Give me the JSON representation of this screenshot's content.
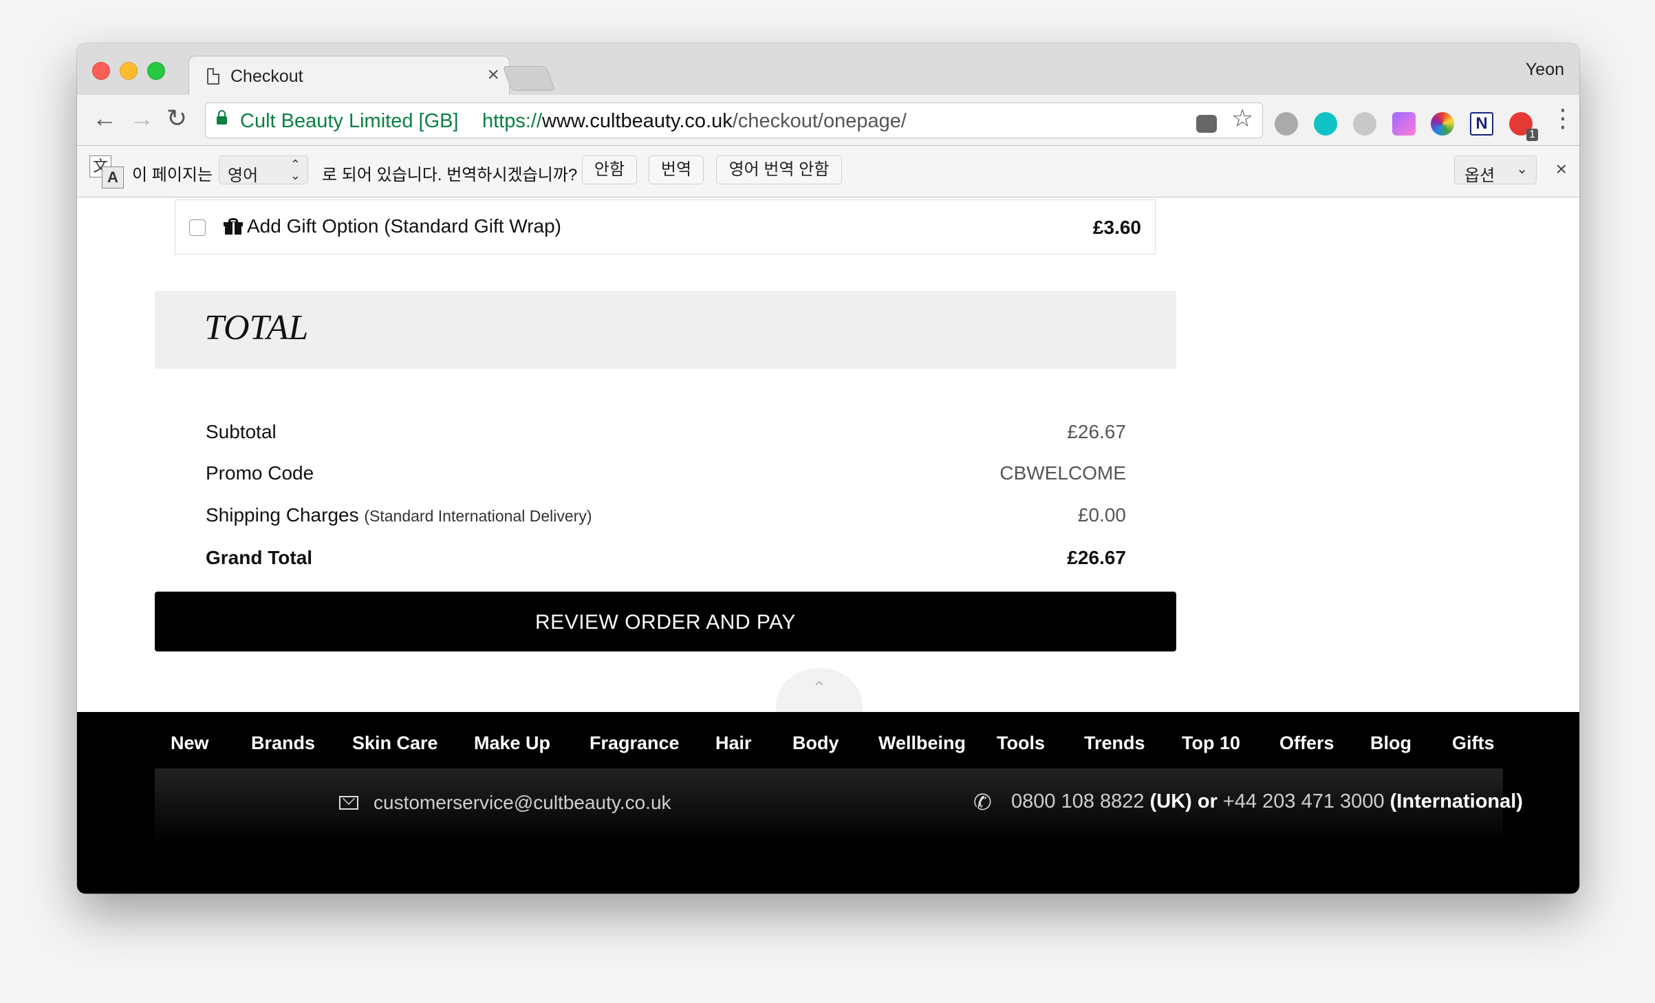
{
  "browser": {
    "tab_title": "Checkout",
    "tab_close": "×",
    "profile_name": "Yeon",
    "back": "←",
    "forward": "→",
    "reload": "↻",
    "ev_label": "Cult Beauty Limited [GB]",
    "url_scheme": "https://",
    "url_host": "www.cultbeauty.co.uk",
    "url_path": "/checkout/onepage/",
    "bookmark_star": "☆",
    "menu_dots": "⋮",
    "extension_badge": "1"
  },
  "translate_bar": {
    "icon_glyph_1": "文",
    "icon_glyph_2": "A",
    "prefix": "이 페이지는",
    "language": "영어",
    "suffix": "로 되어 있습니다. 번역하시겠습니까?",
    "btn_no": "안함",
    "btn_translate": "번역",
    "btn_never": "영어 번역 안함",
    "options": "옵션",
    "close": "×"
  },
  "gift_option": {
    "label": "Add Gift Option (Standard Gift Wrap)",
    "price": "£3.60",
    "checked": false
  },
  "total": {
    "title": "TOTAL",
    "rows": [
      {
        "label": "Subtotal",
        "note": "",
        "value": "£26.67"
      },
      {
        "label": "Promo Code",
        "note": "",
        "value": "CBWELCOME"
      },
      {
        "label": "Shipping Charges",
        "note": "(Standard International Delivery)",
        "value": "£0.00"
      }
    ],
    "grand_label": "Grand Total",
    "grand_value": "£26.67"
  },
  "cta_label": "REVIEW ORDER AND PAY",
  "scroll_top": "⌃",
  "footer": {
    "nav": [
      "New",
      "Brands",
      "Skin Care",
      "Make Up",
      "Fragrance",
      "Hair",
      "Body",
      "Wellbeing",
      "Tools",
      "Trends",
      "Top 10",
      "Offers",
      "Blog",
      "Gifts"
    ],
    "email": "customerservice@cultbeauty.co.uk",
    "phone_uk": "0800 108 8822",
    "phone_uk_label": "(UK) or",
    "phone_intl": "+44 203 471 3000",
    "phone_intl_label": "(International)"
  },
  "colors": {
    "secure_green": "#0b8043",
    "cta_background": "#000000",
    "total_header_bg": "#efefef"
  }
}
